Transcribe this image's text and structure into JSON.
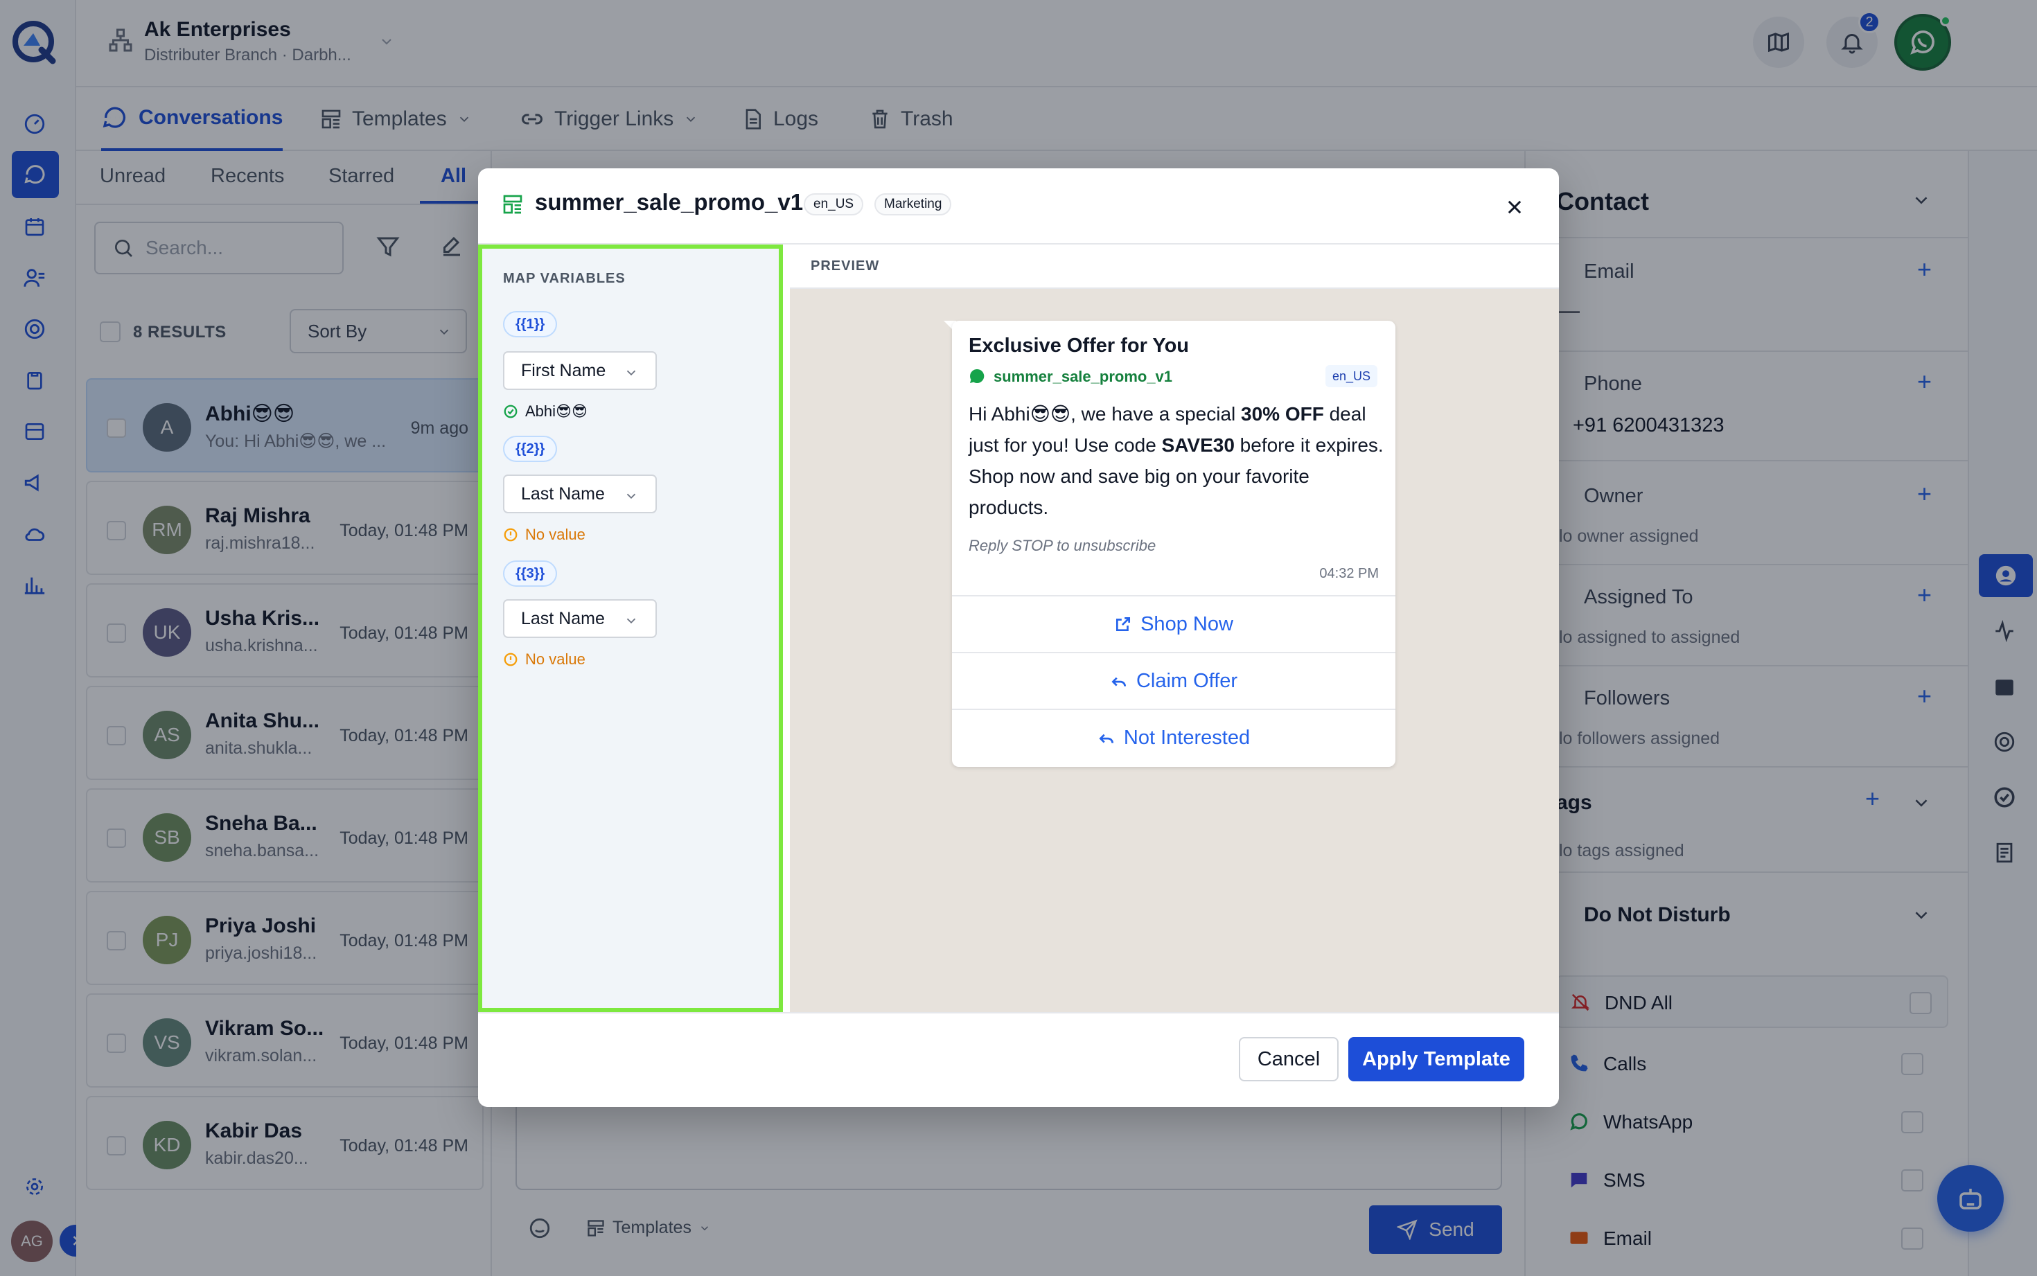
{
  "app": {
    "org_name": "Ak Enterprises",
    "org_sub": "Distributer Branch · Darbh...",
    "notification_count": "2",
    "user_initials": "AG"
  },
  "nav_tabs": [
    {
      "label": "Conversations",
      "icon": "chat-bubble-icon",
      "active": true
    },
    {
      "label": "Templates",
      "icon": "template-icon"
    },
    {
      "label": "Trigger Links",
      "icon": "link-icon"
    },
    {
      "label": "Logs",
      "icon": "document-icon"
    },
    {
      "label": "Trash",
      "icon": "trash-icon"
    }
  ],
  "conv_list": {
    "subtabs": [
      "Unread",
      "Recents",
      "Starred",
      "All"
    ],
    "active_subtab": "All",
    "search_placeholder": "Search...",
    "results_label": "8 RESULTS",
    "sort_label": "Sort By",
    "items": [
      {
        "initials": "A",
        "name": "Abhi😎😎",
        "sub": "You: Hi Abhi😎😎, we ...",
        "time": "9m ago",
        "color": "#5b6b7b",
        "selected": true
      },
      {
        "initials": "RM",
        "name": "Raj Mishra",
        "sub": "raj.mishra18...",
        "time": "Today, 01:48 PM",
        "color": "#7d8c6a"
      },
      {
        "initials": "UK",
        "name": "Usha Kris...",
        "sub": "usha.krishna...",
        "time": "Today, 01:48 PM",
        "color": "#5c5a86"
      },
      {
        "initials": "AS",
        "name": "Anita Shu...",
        "sub": "anita.shukla...",
        "time": "Today, 01:48 PM",
        "color": "#6d8a6a"
      },
      {
        "initials": "SB",
        "name": "Sneha Ba...",
        "sub": "sneha.bansa...",
        "time": "Today, 01:48 PM",
        "color": "#71915f"
      },
      {
        "initials": "PJ",
        "name": "Priya Joshi",
        "sub": "priya.joshi18...",
        "time": "Today, 01:48 PM",
        "color": "#7f9a58"
      },
      {
        "initials": "VS",
        "name": "Vikram So...",
        "sub": "vikram.solan...",
        "time": "Today, 01:48 PM",
        "color": "#65887a"
      },
      {
        "initials": "KD",
        "name": "Kabir Das",
        "sub": "kabir.das20...",
        "time": "Today, 01:48 PM",
        "color": "#6a8d62"
      }
    ]
  },
  "composer": {
    "templates_label": "Templates",
    "send_label": "Send"
  },
  "contact_panel": {
    "title": "Contact",
    "email_label": "Email",
    "email_value": "—",
    "phone_label": "Phone",
    "phone_value": "+91 6200431323",
    "owner_label": "Owner",
    "owner_value": "lo owner assigned",
    "assigned_label": "Assigned To",
    "assigned_value": "lo assigned to assigned",
    "followers_label": "Followers",
    "followers_value": "lo followers assigned",
    "tags_label": "ags",
    "tags_value": "lo tags assigned",
    "dnd_label": "Do Not Disturb",
    "dnd_items": [
      "DND All",
      "Calls",
      "WhatsApp",
      "SMS",
      "Email"
    ]
  },
  "modal": {
    "template_name": "summer_sale_promo_v1",
    "locale": "en_US",
    "category": "Marketing",
    "map_variables_label": "MAP VARIABLES",
    "preview_label": "PREVIEW",
    "variables": [
      {
        "token": "{{1}}",
        "field": "First Name",
        "status": "Abhi😎😎",
        "ok": true
      },
      {
        "token": "{{2}}",
        "field": "Last Name",
        "status": "No value",
        "ok": false
      },
      {
        "token": "{{3}}",
        "field": "Last Name",
        "status": "No value",
        "ok": false
      }
    ],
    "preview": {
      "header": "Exclusive Offer for You",
      "template_name": "summer_sale_promo_v1",
      "locale": "en_US",
      "body_parts": {
        "p1": "Hi Abhi😎😎, we have a special ",
        "b1": "30% OFF",
        "p2": " deal just for you! Use code ",
        "b2": "SAVE30",
        "p3": " before it expires. Shop now and save big on your favorite products."
      },
      "footer": "Reply STOP to unsubscribe",
      "time": "04:32 PM",
      "buttons": [
        "Shop Now",
        "Claim Offer",
        "Not Interested"
      ]
    },
    "cancel_label": "Cancel",
    "apply_label": "Apply Template"
  },
  "colors": {
    "primary": "#1d4ed8",
    "whatsapp": "#16a34a",
    "highlight": "#7ee83f",
    "warning": "#f59e0b"
  }
}
